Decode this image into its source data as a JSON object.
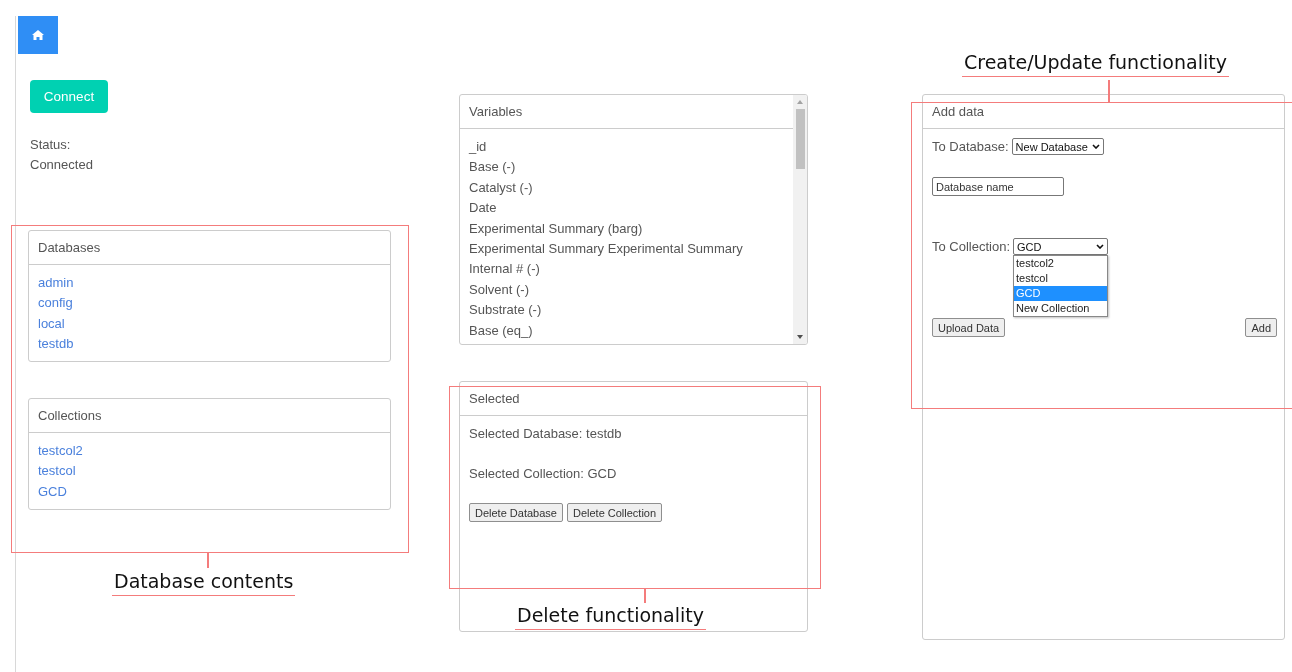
{
  "home_button": {
    "kind": "home"
  },
  "connect_button": {
    "label": "Connect"
  },
  "status": {
    "label": "Status:",
    "value": "Connected"
  },
  "databases": {
    "title": "Databases",
    "items": [
      "admin",
      "config",
      "local",
      "testdb"
    ]
  },
  "collections": {
    "title": "Collections",
    "items": [
      "testcol2",
      "testcol",
      "GCD"
    ]
  },
  "variables": {
    "title": "Variables",
    "items": [
      "_id",
      "Base (-)",
      "Catalyst (-)",
      "Date",
      "Experimental Summary (barg)",
      "Experimental Summary Experimental Summary",
      "Internal # (-)",
      "Solvent (-)",
      "Substrate (-)",
      "Base (eq_)"
    ]
  },
  "selected": {
    "title": "Selected",
    "database": "Selected Database: testdb",
    "collection": "Selected Collection: GCD",
    "buttons": [
      "Delete Database",
      "Delete Collection"
    ]
  },
  "add_data": {
    "title": "Add data",
    "database_label": "To Database:",
    "database_select": "New Database",
    "name_field": {
      "placeholder": "Database name"
    },
    "collection_label": "To Collection:",
    "collection_select": "GCD",
    "collection_options": [
      {
        "label": "testcol2",
        "selected": false
      },
      {
        "label": "testcol",
        "selected": false
      },
      {
        "label": "GCD",
        "selected": true
      },
      {
        "label": "New Collection",
        "selected": false
      }
    ],
    "upload_button": "Upload Data",
    "add_button": "Add"
  },
  "annotations": [
    {
      "label": "Database contents"
    },
    {
      "label": "Delete functionality"
    },
    {
      "label": "Create/Update functionality"
    }
  ]
}
